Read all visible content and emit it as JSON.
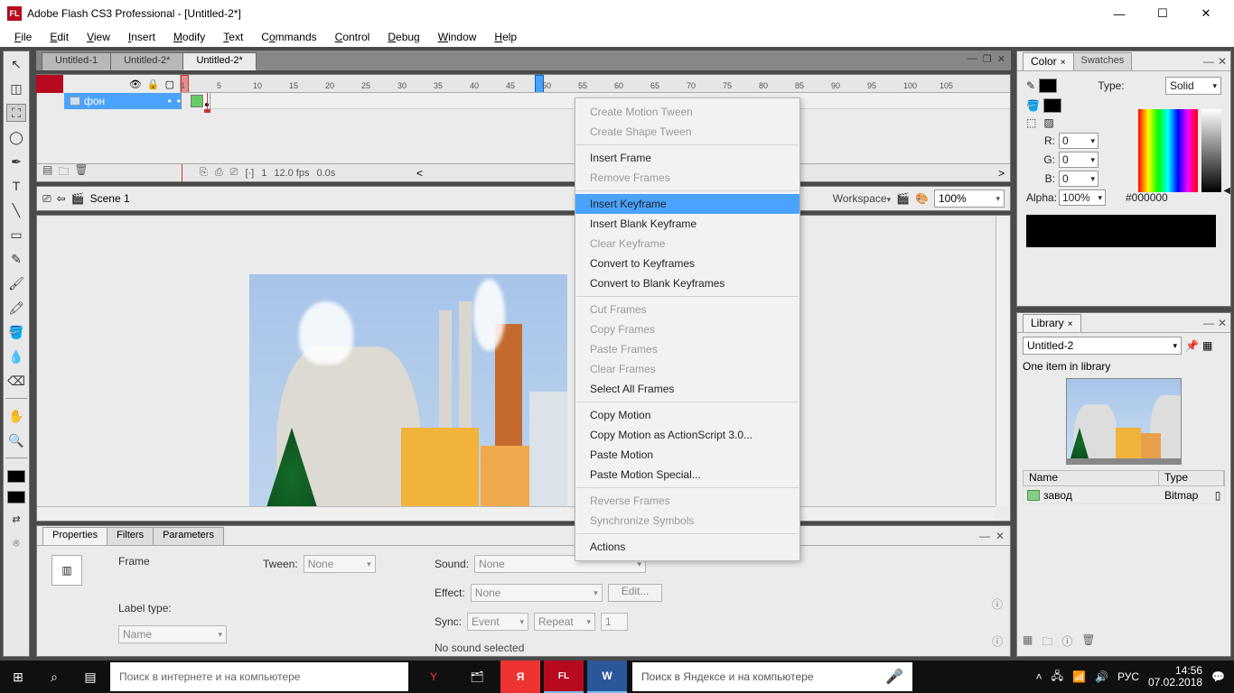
{
  "title": "Adobe Flash CS3 Professional - [Untitled-2*]",
  "menubar": [
    "File",
    "Edit",
    "View",
    "Insert",
    "Modify",
    "Text",
    "Commands",
    "Control",
    "Debug",
    "Window",
    "Help"
  ],
  "doc_tabs": [
    {
      "label": "Untitled-1",
      "active": false
    },
    {
      "label": "Untitled-2*",
      "active": false
    },
    {
      "label": "Untitled-2*",
      "active": true
    }
  ],
  "ruler_marks": [
    "1",
    "5",
    "10",
    "15",
    "20",
    "25",
    "30",
    "35",
    "40",
    "45",
    "50",
    "55",
    "60",
    "65",
    "70",
    "75",
    "80",
    "85",
    "90",
    "95",
    "100",
    "105"
  ],
  "layer": {
    "name": "фон"
  },
  "timeline_footer": {
    "frame": "1",
    "fps": "12.0 fps",
    "time": "0.0s"
  },
  "scene_bar": {
    "scene": "Scene 1",
    "workspace": "Workspace",
    "zoom": "100%"
  },
  "context_menu": [
    {
      "label": "Create Motion Tween",
      "disabled": true
    },
    {
      "label": "Create Shape Tween",
      "disabled": true
    },
    {
      "sep": true
    },
    {
      "label": "Insert Frame"
    },
    {
      "label": "Remove Frames",
      "disabled": true
    },
    {
      "sep": true
    },
    {
      "label": "Insert Keyframe",
      "highlight": true
    },
    {
      "label": "Insert Blank Keyframe"
    },
    {
      "label": "Clear Keyframe",
      "disabled": true
    },
    {
      "label": "Convert to Keyframes"
    },
    {
      "label": "Convert to Blank Keyframes"
    },
    {
      "sep": true
    },
    {
      "label": "Cut Frames",
      "disabled": true
    },
    {
      "label": "Copy Frames",
      "disabled": true
    },
    {
      "label": "Paste Frames",
      "disabled": true
    },
    {
      "label": "Clear Frames",
      "disabled": true
    },
    {
      "label": "Select All Frames"
    },
    {
      "sep": true
    },
    {
      "label": "Copy Motion"
    },
    {
      "label": "Copy Motion as ActionScript 3.0..."
    },
    {
      "label": "Paste Motion"
    },
    {
      "label": "Paste Motion Special..."
    },
    {
      "sep": true
    },
    {
      "label": "Reverse Frames",
      "disabled": true
    },
    {
      "label": "Synchronize Symbols",
      "disabled": true
    },
    {
      "sep": true
    },
    {
      "label": "Actions"
    }
  ],
  "properties": {
    "tabs": [
      "Properties",
      "Filters",
      "Parameters"
    ],
    "frame_label": "Frame",
    "label_type": "Label type:",
    "name_combo": "Name",
    "tween_label": "Tween:",
    "tween_value": "None",
    "sound_label": "Sound:",
    "sound_value": "None",
    "effect_label": "Effect:",
    "effect_value": "None",
    "edit_btn": "Edit...",
    "sync_label": "Sync:",
    "sync_value": "Event",
    "repeat_value": "Repeat",
    "repeat_count": "1",
    "no_sound": "No sound selected"
  },
  "color_panel": {
    "tabs": [
      "Color",
      "Swatches"
    ],
    "type_label": "Type:",
    "type_value": "Solid",
    "r_label": "R:",
    "r": "0",
    "g_label": "G:",
    "g": "0",
    "b_label": "B:",
    "b": "0",
    "alpha_label": "Alpha:",
    "alpha": "100%",
    "hex": "#000000"
  },
  "library_panel": {
    "tab": "Library",
    "doc": "Untitled-2",
    "count": "One item in library",
    "cols": [
      "Name",
      "Type"
    ],
    "row": {
      "name": "завод",
      "type": "Bitmap"
    }
  },
  "taskbar": {
    "search_placeholder": "Поиск в интернете и на компьютере",
    "yandex_placeholder": "Поиск в Яндексе и на компьютере",
    "lang": "РУС",
    "time": "14:56",
    "date": "07.02.2018"
  }
}
